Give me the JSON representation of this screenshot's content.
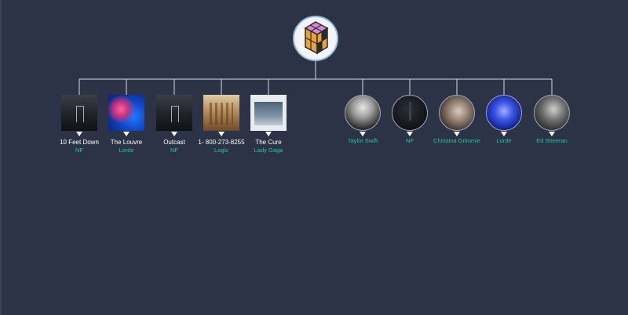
{
  "root": {
    "icon": "cube-icon",
    "colors": [
      "#e6a23c",
      "#d88ad8",
      "#2a2a2a"
    ]
  },
  "albums": [
    {
      "title": "10 Feet Down",
      "artist": "NF",
      "art": "nf-dark"
    },
    {
      "title": "The Louvre",
      "artist": "Lorde",
      "art": "louvre"
    },
    {
      "title": "Outcast",
      "artist": "NF",
      "art": "nf-dark"
    },
    {
      "title": "1- 800-273-8255",
      "artist": "Logic",
      "art": "logic"
    },
    {
      "title": "The Cure",
      "artist": "Lady Gaga",
      "art": "cure"
    }
  ],
  "artists": [
    {
      "name": "Taylor Swift",
      "art": "taylor"
    },
    {
      "name": "NF",
      "art": "nf-circ"
    },
    {
      "name": "Christina Grimmie",
      "art": "christina"
    },
    {
      "name": "Lorde",
      "art": "lorde"
    },
    {
      "name": "Ed Sheeran",
      "art": "ed"
    }
  ],
  "colors": {
    "background": "#2c3346",
    "line": "#d8dbe2",
    "accent": "#1fc7a3",
    "text": "#ffffff"
  }
}
